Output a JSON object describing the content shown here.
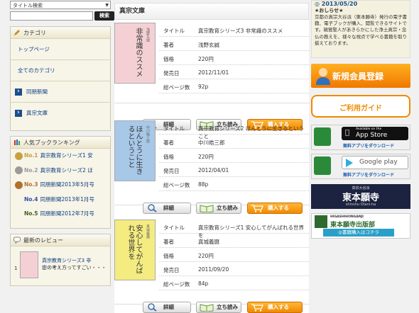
{
  "search": {
    "select": "タイトル検索",
    "button": "検索"
  },
  "category": {
    "heading": "カテゴリ",
    "links": [
      "トップページ",
      "全てのカテゴリ"
    ],
    "items": [
      "同朋新聞",
      "真宗文庫"
    ]
  },
  "ranking": {
    "heading": "人気ブックランキング",
    "items": [
      {
        "no": "No.1",
        "title": "真宗教育シリーズ1 安",
        "color": "#c8a040"
      },
      {
        "no": "No.2",
        "title": "真宗教育シリーズ2 ほ",
        "color": "#9a9a9a"
      },
      {
        "no": "No.3",
        "title": "同朋新聞2013年5月号",
        "color": "#b07030"
      },
      {
        "no": "No.4",
        "title": "同朋新聞2013年1月号",
        "color": "#3050a0"
      },
      {
        "no": "No.5",
        "title": "同朋新聞2012年7月号",
        "color": "#406020"
      }
    ]
  },
  "review": {
    "heading": "最新のレビュー",
    "no": "1",
    "title": "真宗教育シリーズ3 非宗・・・",
    "text": "この考え方ってすごい・・・"
  },
  "main": {
    "title": "真宗文庫",
    "labels": {
      "title": "タイトル",
      "author": "著者",
      "price": "価格",
      "date": "発売日",
      "pages": "総ページ数"
    },
    "buttons": {
      "detail": "詳細",
      "preview": "立ち読み",
      "buy": "購入する"
    },
    "books": [
      {
        "title": "真宗教育シリーズ3 非常識のススメ",
        "author": "浅野玄誠",
        "price": "220円",
        "date": "2012/11/01",
        "pages": "92p",
        "cover_title": "非常識のススメ",
        "cover_author": "浅野玄誠",
        "cover_color": "#f4d0d4"
      },
      {
        "title": "真宗教育シリーズ2 ほんとうに生きるということ",
        "author": "中川皓三郎",
        "price": "220円",
        "date": "2012/04/01",
        "pages": "88p",
        "cover_title": "ほんとうに生きるということ",
        "cover_author": "中川皓三郎",
        "cover_color": "#a8c8e8"
      },
      {
        "title": "真宗教育シリーズ1 安心してがんばれる世界を",
        "author": "真城義麿",
        "price": "220円",
        "date": "2011/09/20",
        "pages": "84p",
        "cover_title": "安心してがんばれる世界を",
        "cover_author": "真城義麿",
        "cover_color": "#f4ec80"
      }
    ]
  },
  "news": {
    "date": "2013/05/20",
    "subtitle": "★おしらせ★",
    "text": "京都の真宗大谷派（東本願寺）発行の電子書籍、電子ブックが購入、閲覧できるサイトです。親鸞聖人があきらかにした浄土真宗・念仏の教えを、様々な視点で学べる書籍を取り揃えております。"
  },
  "banners": {
    "register": "新規会員登録",
    "guide": "ご利用ガイド",
    "appstore_small": "Available on the",
    "appstore": "App Store",
    "googleplay": "Google play",
    "free_app": "無料アプリをダウンロード",
    "temple_small": "真宗大谷派",
    "temple": "東本願寺",
    "temple_roman": "shinshu Otani-ha",
    "pub_small": "HIGASHIHONGANJI",
    "pub": "東本願寺出版部",
    "pub_buy": "◎書籍購入はコチラ"
  }
}
